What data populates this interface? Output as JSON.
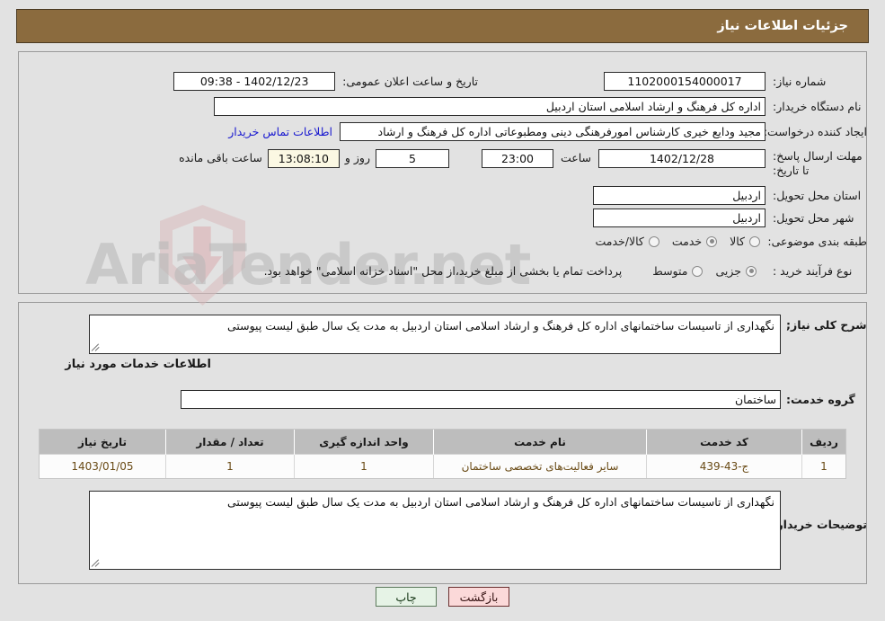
{
  "header": {
    "title": "جزئیات اطلاعات نیاز"
  },
  "watermark": {
    "text": "AriaTender.net"
  },
  "top_panel": {
    "need_number": {
      "label": "شماره نیاز:",
      "value": "1102000154000017"
    },
    "announce_datetime": {
      "label": "تاریخ و ساعت اعلان عمومی:",
      "value": "1402/12/23 - 09:38"
    },
    "buyer_org": {
      "label": "نام دستگاه خریدار:",
      "value": "اداره کل فرهنگ و ارشاد اسلامی استان اردبیل"
    },
    "creator": {
      "label": "ایجاد کننده درخواست:",
      "value": "مجید  ودایع خیری کارشناس امورفرهنگی دینی ومطبوعاتی اداره کل فرهنگ و ارشاد",
      "contact_link": "اطلاعات تماس خریدار"
    },
    "deadline": {
      "label": "مهلت ارسال پاسخ: تا تاریخ:",
      "date": "1402/12/28",
      "time_label": "ساعت",
      "time": "23:00",
      "days": "5",
      "days_label": "روز و",
      "countdown": "13:08:10",
      "remaining_label": "ساعت باقی مانده"
    },
    "delivery_province": {
      "label": "استان محل تحویل:",
      "value": "اردبیل"
    },
    "delivery_city": {
      "label": "شهر محل تحویل:",
      "value": "اردبیل"
    },
    "category": {
      "label": "طبقه بندی موضوعی:",
      "options": [
        {
          "label": "کالا",
          "checked": false
        },
        {
          "label": "خدمت",
          "checked": true
        },
        {
          "label": "کالا/خدمت",
          "checked": false
        }
      ]
    },
    "purchase_type": {
      "label": "نوع فرآیند خرید :",
      "options": [
        {
          "label": "جزیی",
          "checked": true
        },
        {
          "label": "متوسط",
          "checked": false
        }
      ],
      "note": "پرداخت تمام یا بخشی از مبلغ خرید،از محل \"اسناد خزانه اسلامی\" خواهد بود."
    }
  },
  "bottom_panel": {
    "summary": {
      "label": "شرح کلی نیاز;",
      "value": "نگهداری از تاسیسات ساختمانهای اداره کل فرهنگ و ارشاد اسلامی استان اردبیل به مدت یک سال طبق لیست پیوستی"
    },
    "services_heading": "اطلاعات خدمات مورد نیاز",
    "service_group": {
      "label": "گروه خدمت:",
      "value": "ساختمان"
    },
    "table": {
      "headers": [
        "ردیف",
        "کد خدمت",
        "نام خدمت",
        "واحد اندازه گیری",
        "تعداد / مقدار",
        "تاریخ نیاز"
      ],
      "rows": [
        {
          "index": "1",
          "service_code": "ج-43-439",
          "service_name": "سایر فعالیت‌های تخصصی ساختمان",
          "unit": "1",
          "quantity": "1",
          "need_date": "1403/01/05"
        }
      ]
    },
    "buyer_notes": {
      "label": "توضیحات خریدار;",
      "value": "نگهداری از تاسیسات ساختمانهای اداره کل فرهنگ و ارشاد اسلامی استان اردبیل به مدت یک سال طبق لیست پیوستی"
    }
  },
  "footer": {
    "print_button": "چاپ",
    "back_button": "بازگشت"
  }
}
